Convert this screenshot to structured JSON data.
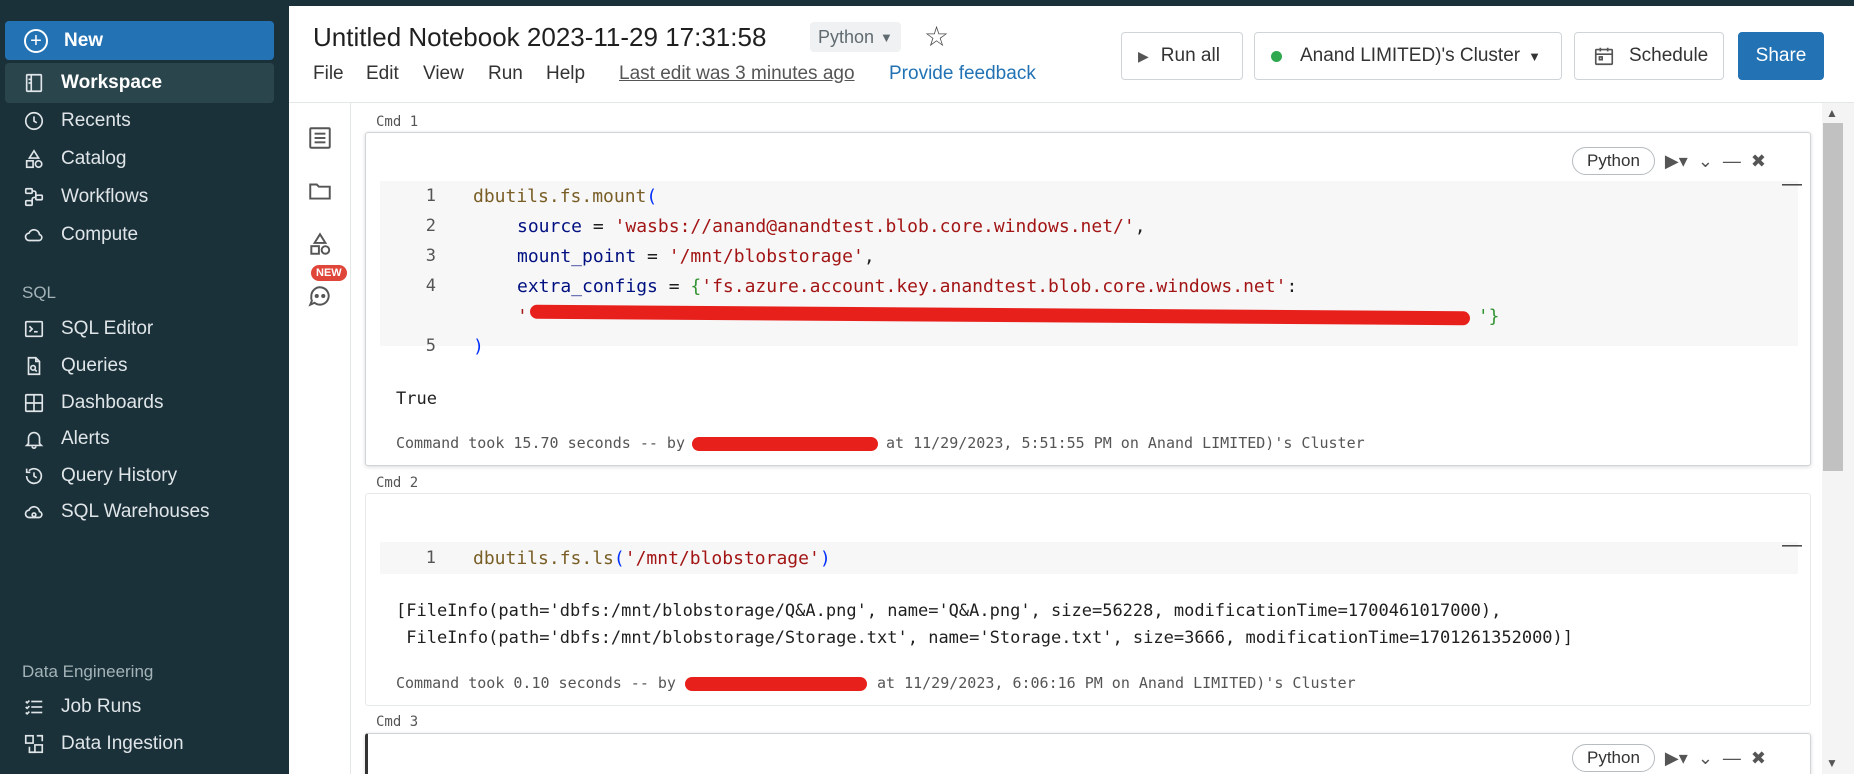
{
  "sidebar": {
    "new_label": "New",
    "items": [
      {
        "label": "Workspace",
        "icon": "workspace-icon"
      },
      {
        "label": "Recents",
        "icon": "clock-icon"
      },
      {
        "label": "Catalog",
        "icon": "catalog-icon"
      },
      {
        "label": "Workflows",
        "icon": "workflows-icon"
      },
      {
        "label": "Compute",
        "icon": "cloud-icon"
      }
    ],
    "sql_section": "SQL",
    "sql_items": [
      {
        "label": "SQL Editor",
        "icon": "terminal-icon"
      },
      {
        "label": "Queries",
        "icon": "file-icon"
      },
      {
        "label": "Dashboards",
        "icon": "grid-icon"
      },
      {
        "label": "Alerts",
        "icon": "bell-icon"
      },
      {
        "label": "Query History",
        "icon": "history-icon"
      },
      {
        "label": "SQL Warehouses",
        "icon": "cloud-icon"
      }
    ],
    "de_section": "Data Engineering",
    "de_items": [
      {
        "label": "Job Runs",
        "icon": "list-icon"
      },
      {
        "label": "Data Ingestion",
        "icon": "ingestion-icon"
      }
    ]
  },
  "header": {
    "title": "Untitled Notebook 2023-11-29 17:31:58",
    "language": "Python",
    "menu": [
      "File",
      "Edit",
      "View",
      "Run",
      "Help"
    ],
    "last_edit": "Last edit was 3 minutes ago",
    "feedback": "Provide feedback",
    "run_all": "Run all",
    "cluster": "Anand LIMITED)'s Cluster",
    "schedule": "Schedule",
    "share": "Share"
  },
  "rail": {
    "new_badge": "NEW"
  },
  "cells": [
    {
      "cmd": "Cmd 1",
      "lang": "Python",
      "line_numbers": [
        "1",
        "2",
        "3",
        "4",
        "5"
      ],
      "code": {
        "l1_fn": "dbutils.fs.mount",
        "l1_br": "(",
        "l2_var": "source",
        "l2_eq": " = ",
        "l2_str": "'wasbs://anand@anandtest.blob.core.windows.net/'",
        "l2_end": ",",
        "l3_var": "mount_point",
        "l3_eq": " = ",
        "l3_str": "'/mnt/blobstorage'",
        "l3_end": ",",
        "l4_var": "extra_configs",
        "l4_eq": " = ",
        "l4_br": "{",
        "l4_str": "'fs.azure.account.key.anandtest.blob.core.windows.net'",
        "l4_end": ":",
        "l4b_str": "'",
        "l4b_end": "'}",
        "l5_br": ")"
      },
      "output": "True",
      "took": "Command took 15.70 seconds -- by",
      "took_after": "at 11/29/2023, 5:51:55 PM on Anand LIMITED)'s Cluster"
    },
    {
      "cmd": "Cmd 2",
      "line_numbers": [
        "1"
      ],
      "code": {
        "l1_fn": "dbutils.fs.ls",
        "l1_br": "(",
        "l1_str": "'/mnt/blobstorage'",
        "l1_end": ")"
      },
      "output_lines": [
        "[FileInfo(path='dbfs:/mnt/blobstorage/Q&A.png', name='Q&A.png', size=56228, modificationTime=1700461017000),",
        " FileInfo(path='dbfs:/mnt/blobstorage/Storage.txt', name='Storage.txt', size=3666, modificationTime=1701261352000)]"
      ],
      "took": "Command took 0.10 seconds -- by",
      "took_after": "at 11/29/2023, 6:06:16 PM on Anand LIMITED)'s Cluster"
    },
    {
      "cmd": "Cmd 3",
      "lang": "Python"
    }
  ],
  "colors": {
    "sidebar_bg": "#1b3139",
    "accent": "#2272b4",
    "cluster_status": "#2fa84f",
    "redaction": "#e8201c"
  }
}
